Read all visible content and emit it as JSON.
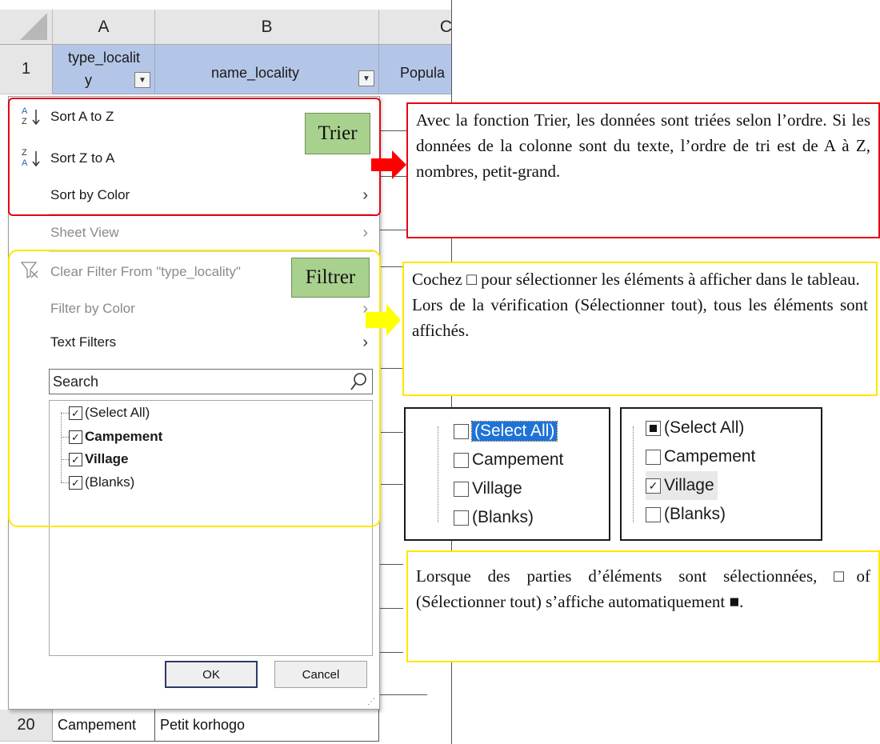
{
  "sheet": {
    "columns": [
      "A",
      "B",
      "C"
    ],
    "row_header_1": "1",
    "header_cells": [
      "type_locality",
      "name_locality",
      "Popula"
    ],
    "header_cell_a_line1": "type_localit",
    "header_cell_a_line2": "y",
    "bottom_row_num": "20",
    "bottom_row_a": "Campement",
    "bottom_row_b": "Petit korhogo"
  },
  "menu": {
    "sort_az": "Sort A to Z",
    "sort_za": "Sort Z to A",
    "sort_by_color": "Sort by Color",
    "sheet_view": "Sheet View",
    "clear_filter": "Clear Filter From \"type_locality\"",
    "filter_by_color": "Filter by Color",
    "text_filters": "Text Filters",
    "search_placeholder": "Search",
    "items": [
      "(Select All)",
      "Campement",
      "Village",
      "(Blanks)"
    ],
    "ok": "OK",
    "cancel": "Cancel"
  },
  "tags": {
    "sort": "Trier",
    "filter": "Filtrer"
  },
  "callouts": {
    "sort": "Avec la fonction Trier, les données sont triées selon l’ordre. Si les données de la colonne sont du texte, l’ordre de tri est de A à Z, nombres, petit-grand.",
    "filter_line1": "Cochez □ pour sélectionner les éléments à afficher dans le tableau.",
    "filter_line2": "Lors de la vérification (Sélectionner tout), tous les éléments sont affichés.",
    "partial": "Lorsque des parties d’éléments sont sélectionnées, □of (Sélectionner tout) s’affiche automatiquement ■."
  },
  "panel_left": {
    "items": [
      "(Select All)",
      "Campement",
      "Village",
      "(Blanks)"
    ]
  },
  "panel_right": {
    "items": [
      "(Select All)",
      "Campement",
      "Village",
      "(Blanks)"
    ]
  },
  "colors": {
    "red": "#e30613",
    "yellow": "#ffe600",
    "tag_green": "#a9d18e",
    "header_blue": "#b4c6e7"
  }
}
